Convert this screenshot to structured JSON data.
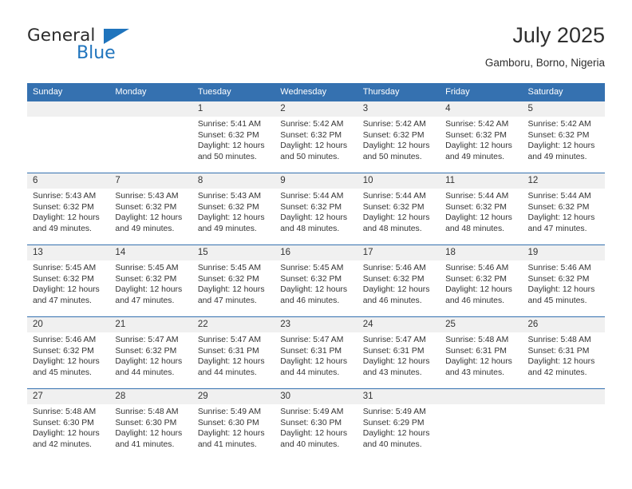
{
  "brand": {
    "name_top": "General",
    "name_bottom": "Blue",
    "triangle_color": "#1f74bd"
  },
  "header": {
    "title": "July 2025",
    "subtitle": "Gamboru, Borno, Nigeria"
  },
  "theme": {
    "header_blue": "#3571b0",
    "daynum_bg": "#f0f0f0",
    "text": "#343434"
  },
  "weekday_headers": [
    "Sunday",
    "Monday",
    "Tuesday",
    "Wednesday",
    "Thursday",
    "Friday",
    "Saturday"
  ],
  "labels": {
    "sunrise_prefix": "Sunrise:",
    "sunset_prefix": "Sunset:",
    "daylight_prefix": "Daylight:"
  },
  "weeks": [
    [
      {
        "day": "",
        "sunrise": "",
        "sunset": "",
        "daylight_line1": "",
        "daylight_line2": ""
      },
      {
        "day": "",
        "sunrise": "",
        "sunset": "",
        "daylight_line1": "",
        "daylight_line2": ""
      },
      {
        "day": "1",
        "sunrise": "Sunrise: 5:41 AM",
        "sunset": "Sunset: 6:32 PM",
        "daylight_line1": "Daylight: 12 hours",
        "daylight_line2": "and 50 minutes."
      },
      {
        "day": "2",
        "sunrise": "Sunrise: 5:42 AM",
        "sunset": "Sunset: 6:32 PM",
        "daylight_line1": "Daylight: 12 hours",
        "daylight_line2": "and 50 minutes."
      },
      {
        "day": "3",
        "sunrise": "Sunrise: 5:42 AM",
        "sunset": "Sunset: 6:32 PM",
        "daylight_line1": "Daylight: 12 hours",
        "daylight_line2": "and 50 minutes."
      },
      {
        "day": "4",
        "sunrise": "Sunrise: 5:42 AM",
        "sunset": "Sunset: 6:32 PM",
        "daylight_line1": "Daylight: 12 hours",
        "daylight_line2": "and 49 minutes."
      },
      {
        "day": "5",
        "sunrise": "Sunrise: 5:42 AM",
        "sunset": "Sunset: 6:32 PM",
        "daylight_line1": "Daylight: 12 hours",
        "daylight_line2": "and 49 minutes."
      }
    ],
    [
      {
        "day": "6",
        "sunrise": "Sunrise: 5:43 AM",
        "sunset": "Sunset: 6:32 PM",
        "daylight_line1": "Daylight: 12 hours",
        "daylight_line2": "and 49 minutes."
      },
      {
        "day": "7",
        "sunrise": "Sunrise: 5:43 AM",
        "sunset": "Sunset: 6:32 PM",
        "daylight_line1": "Daylight: 12 hours",
        "daylight_line2": "and 49 minutes."
      },
      {
        "day": "8",
        "sunrise": "Sunrise: 5:43 AM",
        "sunset": "Sunset: 6:32 PM",
        "daylight_line1": "Daylight: 12 hours",
        "daylight_line2": "and 49 minutes."
      },
      {
        "day": "9",
        "sunrise": "Sunrise: 5:44 AM",
        "sunset": "Sunset: 6:32 PM",
        "daylight_line1": "Daylight: 12 hours",
        "daylight_line2": "and 48 minutes."
      },
      {
        "day": "10",
        "sunrise": "Sunrise: 5:44 AM",
        "sunset": "Sunset: 6:32 PM",
        "daylight_line1": "Daylight: 12 hours",
        "daylight_line2": "and 48 minutes."
      },
      {
        "day": "11",
        "sunrise": "Sunrise: 5:44 AM",
        "sunset": "Sunset: 6:32 PM",
        "daylight_line1": "Daylight: 12 hours",
        "daylight_line2": "and 48 minutes."
      },
      {
        "day": "12",
        "sunrise": "Sunrise: 5:44 AM",
        "sunset": "Sunset: 6:32 PM",
        "daylight_line1": "Daylight: 12 hours",
        "daylight_line2": "and 47 minutes."
      }
    ],
    [
      {
        "day": "13",
        "sunrise": "Sunrise: 5:45 AM",
        "sunset": "Sunset: 6:32 PM",
        "daylight_line1": "Daylight: 12 hours",
        "daylight_line2": "and 47 minutes."
      },
      {
        "day": "14",
        "sunrise": "Sunrise: 5:45 AM",
        "sunset": "Sunset: 6:32 PM",
        "daylight_line1": "Daylight: 12 hours",
        "daylight_line2": "and 47 minutes."
      },
      {
        "day": "15",
        "sunrise": "Sunrise: 5:45 AM",
        "sunset": "Sunset: 6:32 PM",
        "daylight_line1": "Daylight: 12 hours",
        "daylight_line2": "and 47 minutes."
      },
      {
        "day": "16",
        "sunrise": "Sunrise: 5:45 AM",
        "sunset": "Sunset: 6:32 PM",
        "daylight_line1": "Daylight: 12 hours",
        "daylight_line2": "and 46 minutes."
      },
      {
        "day": "17",
        "sunrise": "Sunrise: 5:46 AM",
        "sunset": "Sunset: 6:32 PM",
        "daylight_line1": "Daylight: 12 hours",
        "daylight_line2": "and 46 minutes."
      },
      {
        "day": "18",
        "sunrise": "Sunrise: 5:46 AM",
        "sunset": "Sunset: 6:32 PM",
        "daylight_line1": "Daylight: 12 hours",
        "daylight_line2": "and 46 minutes."
      },
      {
        "day": "19",
        "sunrise": "Sunrise: 5:46 AM",
        "sunset": "Sunset: 6:32 PM",
        "daylight_line1": "Daylight: 12 hours",
        "daylight_line2": "and 45 minutes."
      }
    ],
    [
      {
        "day": "20",
        "sunrise": "Sunrise: 5:46 AM",
        "sunset": "Sunset: 6:32 PM",
        "daylight_line1": "Daylight: 12 hours",
        "daylight_line2": "and 45 minutes."
      },
      {
        "day": "21",
        "sunrise": "Sunrise: 5:47 AM",
        "sunset": "Sunset: 6:32 PM",
        "daylight_line1": "Daylight: 12 hours",
        "daylight_line2": "and 44 minutes."
      },
      {
        "day": "22",
        "sunrise": "Sunrise: 5:47 AM",
        "sunset": "Sunset: 6:31 PM",
        "daylight_line1": "Daylight: 12 hours",
        "daylight_line2": "and 44 minutes."
      },
      {
        "day": "23",
        "sunrise": "Sunrise: 5:47 AM",
        "sunset": "Sunset: 6:31 PM",
        "daylight_line1": "Daylight: 12 hours",
        "daylight_line2": "and 44 minutes."
      },
      {
        "day": "24",
        "sunrise": "Sunrise: 5:47 AM",
        "sunset": "Sunset: 6:31 PM",
        "daylight_line1": "Daylight: 12 hours",
        "daylight_line2": "and 43 minutes."
      },
      {
        "day": "25",
        "sunrise": "Sunrise: 5:48 AM",
        "sunset": "Sunset: 6:31 PM",
        "daylight_line1": "Daylight: 12 hours",
        "daylight_line2": "and 43 minutes."
      },
      {
        "day": "26",
        "sunrise": "Sunrise: 5:48 AM",
        "sunset": "Sunset: 6:31 PM",
        "daylight_line1": "Daylight: 12 hours",
        "daylight_line2": "and 42 minutes."
      }
    ],
    [
      {
        "day": "27",
        "sunrise": "Sunrise: 5:48 AM",
        "sunset": "Sunset: 6:30 PM",
        "daylight_line1": "Daylight: 12 hours",
        "daylight_line2": "and 42 minutes."
      },
      {
        "day": "28",
        "sunrise": "Sunrise: 5:48 AM",
        "sunset": "Sunset: 6:30 PM",
        "daylight_line1": "Daylight: 12 hours",
        "daylight_line2": "and 41 minutes."
      },
      {
        "day": "29",
        "sunrise": "Sunrise: 5:49 AM",
        "sunset": "Sunset: 6:30 PM",
        "daylight_line1": "Daylight: 12 hours",
        "daylight_line2": "and 41 minutes."
      },
      {
        "day": "30",
        "sunrise": "Sunrise: 5:49 AM",
        "sunset": "Sunset: 6:30 PM",
        "daylight_line1": "Daylight: 12 hours",
        "daylight_line2": "and 40 minutes."
      },
      {
        "day": "31",
        "sunrise": "Sunrise: 5:49 AM",
        "sunset": "Sunset: 6:29 PM",
        "daylight_line1": "Daylight: 12 hours",
        "daylight_line2": "and 40 minutes."
      },
      {
        "day": "",
        "sunrise": "",
        "sunset": "",
        "daylight_line1": "",
        "daylight_line2": ""
      },
      {
        "day": "",
        "sunrise": "",
        "sunset": "",
        "daylight_line1": "",
        "daylight_line2": ""
      }
    ]
  ]
}
